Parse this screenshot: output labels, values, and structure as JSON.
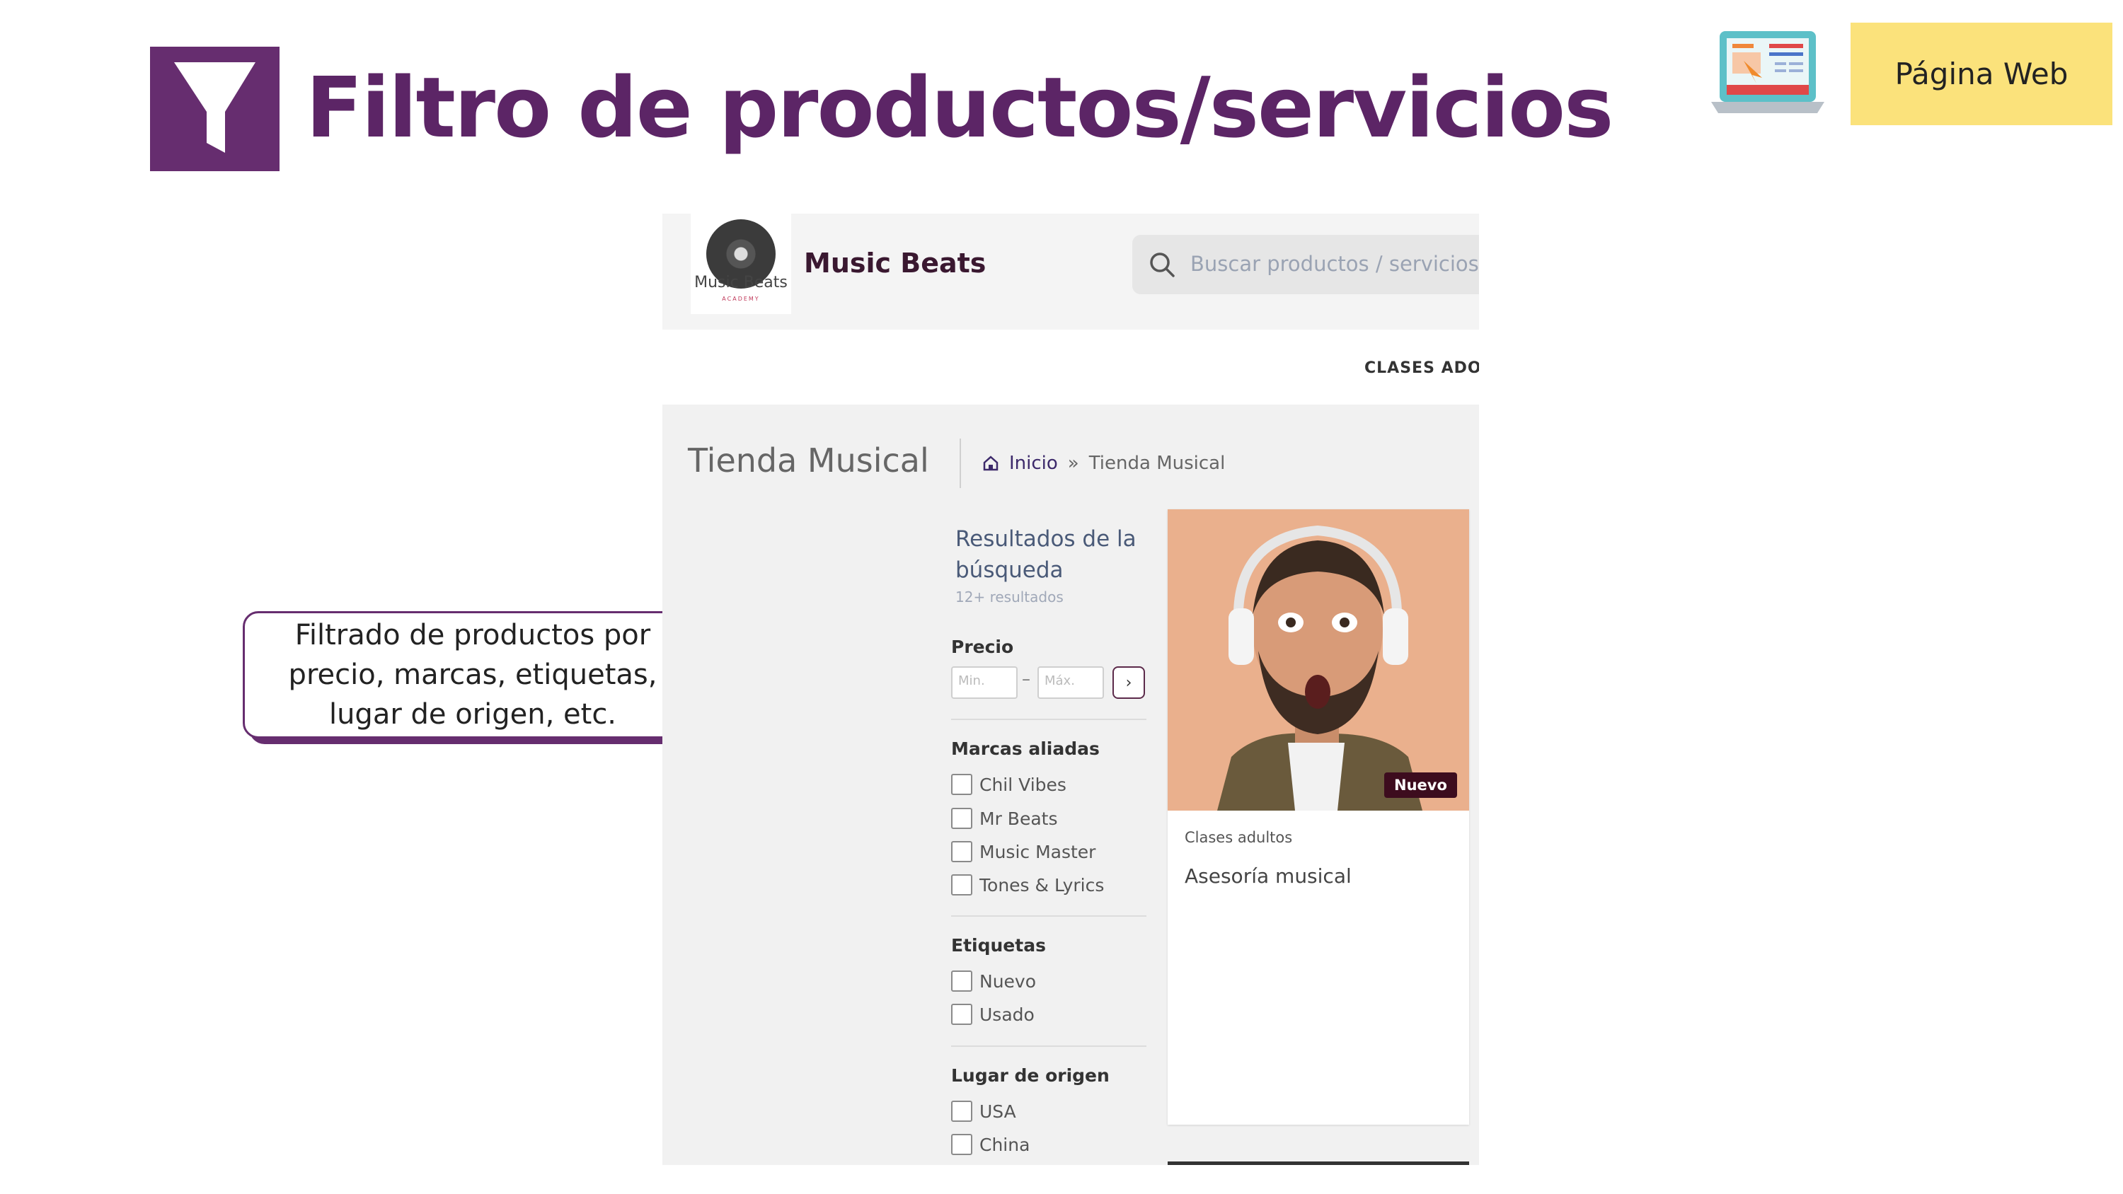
{
  "slide": {
    "title": "Filtro de productos/servicios",
    "badge_label": "Página Web",
    "callout_text": "Filtrado de productos por precio, marcas, etiquetas, lugar de origen, etc.",
    "colors": {
      "accent": "#662d6f",
      "badge_bg": "#fbe27b"
    },
    "icons": [
      "funnel-icon",
      "laptop-web-icon",
      "arrow-icon"
    ]
  },
  "site": {
    "logo": {
      "text": "Music Beats",
      "sub": "ACADEMY"
    },
    "brand_name": "Music Beats",
    "search": {
      "placeholder": "Buscar productos / servicios"
    },
    "nav_item": "CLASES ADOLE"
  },
  "page": {
    "title": "Tienda Musical",
    "breadcrumb": {
      "home": "Inicio",
      "separator": "»",
      "current": "Tienda Musical"
    }
  },
  "filters": {
    "results_title": "Resultados de la búsqueda",
    "results_count": "12+ resultados",
    "price": {
      "heading": "Precio",
      "min_placeholder": "Min.",
      "max_placeholder": "Máx.",
      "dash": "–",
      "go": "›"
    },
    "brands": {
      "heading": "Marcas aliadas",
      "items": [
        "Chil Vibes",
        "Mr Beats",
        "Music Master",
        "Tones & Lyrics"
      ]
    },
    "tags": {
      "heading": "Etiquetas",
      "items": [
        "Nuevo",
        "Usado"
      ]
    },
    "origin": {
      "heading": "Lugar de origen",
      "items": [
        "USA",
        "China"
      ]
    }
  },
  "product": {
    "badge": "Nuevo",
    "category": "Clases adultos",
    "name": "Asesoría musical"
  }
}
